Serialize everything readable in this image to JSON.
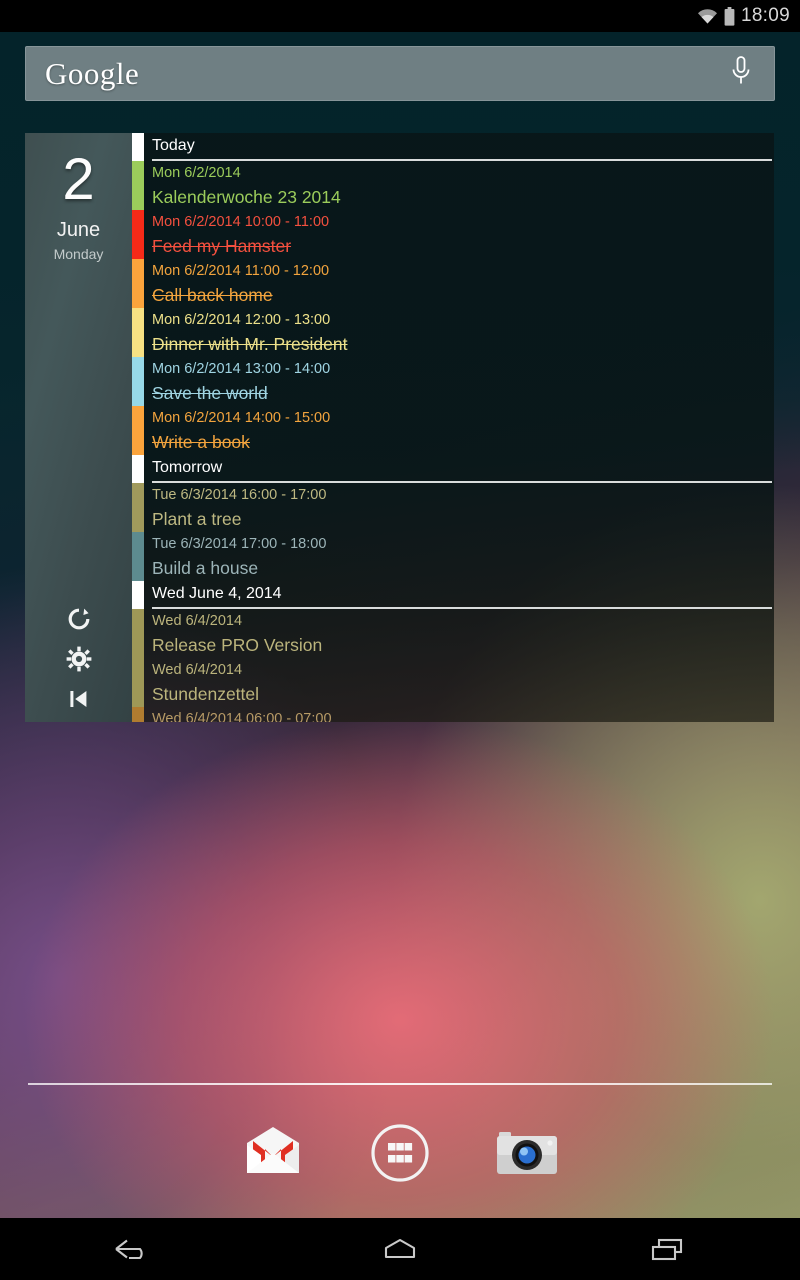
{
  "status_bar": {
    "time": "18:09",
    "wifi_icon": "wifi-icon",
    "battery_icon": "battery-icon"
  },
  "search_widget": {
    "logo_text": "Google",
    "mic_icon": "microphone-icon"
  },
  "calendar_widget": {
    "date_panel": {
      "day_number": "2",
      "month": "June",
      "weekday": "Monday",
      "controls": [
        {
          "name": "refresh-icon",
          "label": "Refresh"
        },
        {
          "name": "settings-gear-icon",
          "label": "Settings"
        },
        {
          "name": "skip-to-start-icon",
          "label": "Go to today"
        }
      ]
    },
    "rows": [
      {
        "kind": "header",
        "title": "Today",
        "bar_color": "#ffffff"
      },
      {
        "kind": "event",
        "when": "Mon 6/2/2014",
        "title": "Kalenderwoche 23 2014",
        "bar_color": "#9bcc5b",
        "text_color": "#9bcc5b",
        "done": false
      },
      {
        "kind": "event",
        "when": "Mon 6/2/2014 10:00 - 11:00",
        "title": "Feed my Hamster",
        "bar_color": "#f52a18",
        "text_color": "#f4503f",
        "done": true
      },
      {
        "kind": "event",
        "when": "Mon 6/2/2014 11:00 - 12:00",
        "title": "Call back home",
        "bar_color": "#fba43c",
        "text_color": "#f2a43e",
        "done": true
      },
      {
        "kind": "event",
        "when": "Mon 6/2/2014 12:00 - 13:00",
        "title": "Dinner with Mr. President",
        "bar_color": "#f7e183",
        "text_color": "#ece08a",
        "done": true
      },
      {
        "kind": "event",
        "when": "Mon 6/2/2014 13:00 - 14:00",
        "title": "Save the world",
        "bar_color": "#97d9e8",
        "text_color": "#9fd4e2",
        "done": true
      },
      {
        "kind": "event",
        "when": "Mon 6/2/2014 14:00 - 15:00",
        "title": "Write a book",
        "bar_color": "#fba43c",
        "text_color": "#f2a43e",
        "done": true
      },
      {
        "kind": "header",
        "title": "Tomorrow",
        "bar_color": "#ffffff"
      },
      {
        "kind": "event",
        "when": "Tue 6/3/2014 16:00 - 17:00",
        "title": "Plant a tree",
        "bar_color": "#a09a5c",
        "text_color": "#bdb882",
        "done": false
      },
      {
        "kind": "event",
        "when": "Tue 6/3/2014 17:00 - 18:00",
        "title": "Build a house",
        "bar_color": "#5d8b8f",
        "text_color": "#9cb4b8",
        "done": false
      },
      {
        "kind": "header",
        "title": "Wed June 4, 2014",
        "bar_color": "#ffffff"
      },
      {
        "kind": "event",
        "when": "Wed 6/4/2014",
        "title": "Release PRO Version",
        "bar_color": "#9e9857",
        "text_color": "#bbb47c",
        "done": false
      },
      {
        "kind": "event",
        "when": "Wed 6/4/2014",
        "title": "Stundenzettel",
        "bar_color": "#9e9857",
        "text_color": "#bbb47c",
        "done": false
      },
      {
        "kind": "event",
        "when": "Wed 6/4/2014 06:00 - 07:00",
        "title": "",
        "bar_color": "#b07c30",
        "text_color": "#b79a66",
        "done": false
      }
    ]
  },
  "dock": {
    "items": [
      {
        "name": "gmail-icon",
        "label": "Gmail"
      },
      {
        "name": "app-drawer-icon",
        "label": "Apps"
      },
      {
        "name": "camera-icon",
        "label": "Camera"
      }
    ]
  },
  "nav_bar": {
    "items": [
      {
        "name": "back-button",
        "label": "Back"
      },
      {
        "name": "home-button",
        "label": "Home"
      },
      {
        "name": "recents-button",
        "label": "Recent apps"
      }
    ]
  }
}
